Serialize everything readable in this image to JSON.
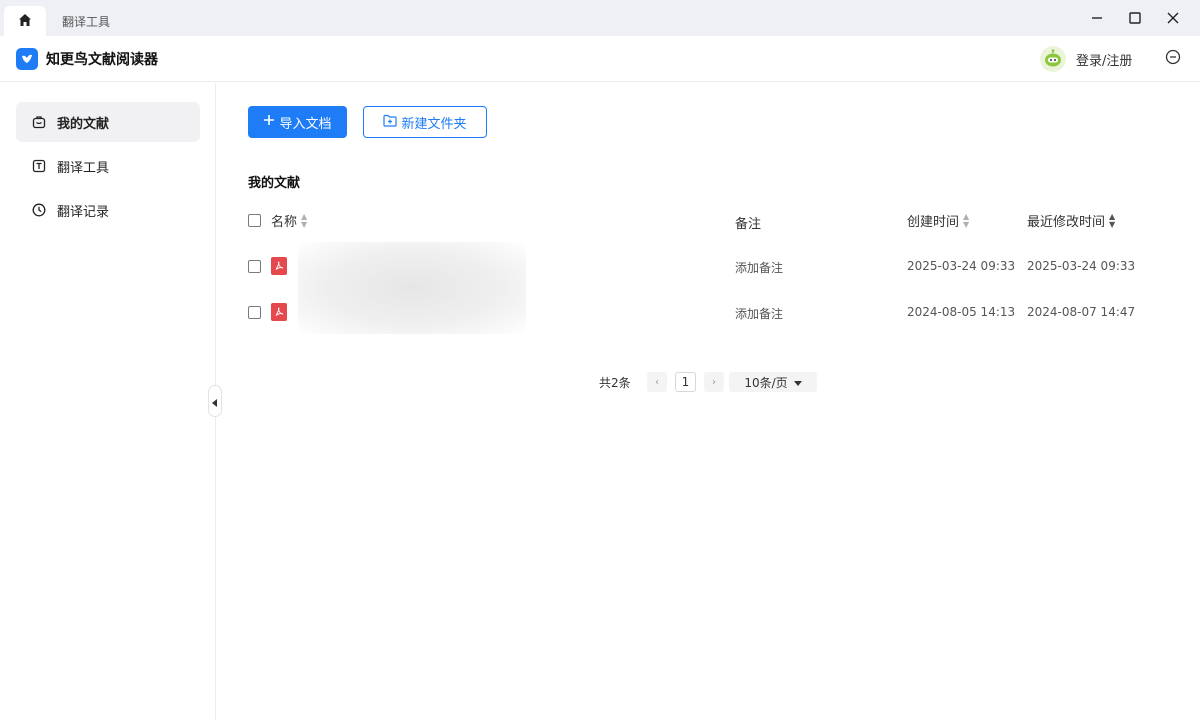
{
  "tabs": {
    "home_icon": "home-icon",
    "items": [
      {
        "label": "翻译工具"
      }
    ]
  },
  "window_controls": [
    "minimize-icon",
    "maximize-icon",
    "close-icon"
  ],
  "header": {
    "app_title": "知更鸟文献阅读器",
    "login_label": "登录/注册"
  },
  "sidebar": {
    "items": [
      {
        "label": "我的文献",
        "icon": "briefcase-icon",
        "active": true
      },
      {
        "label": "翻译工具",
        "icon": "translate-icon",
        "active": false
      },
      {
        "label": "翻译记录",
        "icon": "clock-icon",
        "active": false
      }
    ]
  },
  "toolbar": {
    "import_label": "导入文档",
    "new_folder_label": "新建文件夹"
  },
  "main": {
    "section_title": "我的文献",
    "columns": {
      "name": "名称",
      "note": "备注",
      "created": "创建时间",
      "modified": "最近修改时间"
    },
    "rows": [
      {
        "note": "添加备注",
        "created": "2025-03-24 09:33",
        "modified": "2025-03-24 09:33"
      },
      {
        "note": "添加备注",
        "created": "2024-08-05 14:13",
        "modified": "2024-08-07 14:47"
      }
    ]
  },
  "pagination": {
    "total": "共2条",
    "current_page": "1",
    "page_size": "10条/页"
  },
  "colors": {
    "accent": "#1e7cf7",
    "pdf_red": "#e5484d"
  }
}
